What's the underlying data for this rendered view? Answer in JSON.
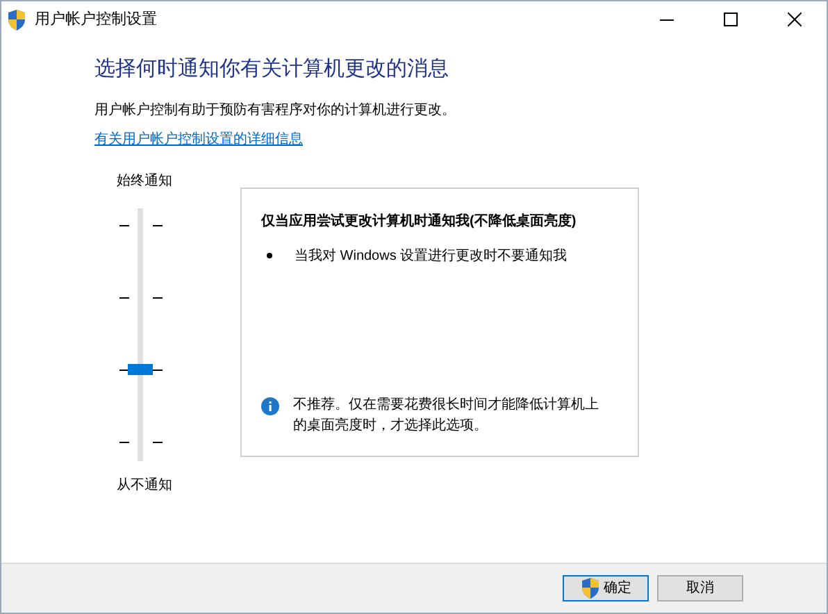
{
  "window": {
    "title": "用户帐户控制设置"
  },
  "heading": "选择何时通知你有关计算机更改的消息",
  "description": "用户帐户控制有助于预防有害程序对你的计算机进行更改。",
  "link": "有关用户帐户控制设置的详细信息",
  "slider": {
    "top_label": "始终通知",
    "bottom_label": "从不通知",
    "level": 0.333
  },
  "panel": {
    "title": "仅当应用尝试更改计算机时通知我(不降低桌面亮度)",
    "bullets": [
      "当我对 Windows 设置进行更改时不要通知我"
    ],
    "note": "不推荐。仅在需要花费很长时间才能降低计算机上的桌面亮度时，才选择此选项。"
  },
  "buttons": [
    {
      "label": "确定",
      "shield": true,
      "default": true
    },
    {
      "label": "取消",
      "shield": false,
      "default": false
    }
  ]
}
